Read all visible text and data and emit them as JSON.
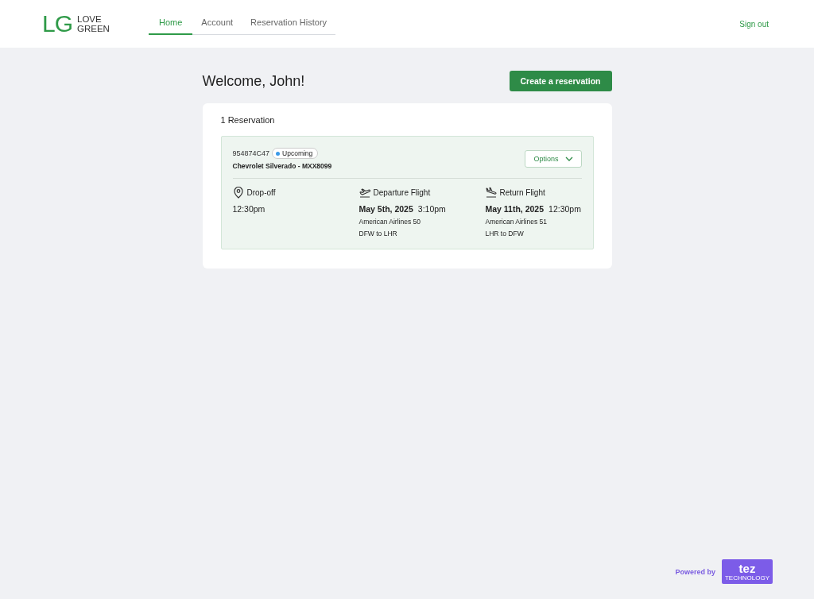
{
  "brand": {
    "mark": "LG",
    "name_lines": [
      "LOVE",
      "GREEN"
    ]
  },
  "nav": {
    "tabs": [
      {
        "label": "Home",
        "selected": true
      },
      {
        "label": "Account",
        "selected": false
      },
      {
        "label": "Reservation History",
        "selected": false
      }
    ],
    "sign_out": "Sign out"
  },
  "welcome": "Welcome, John!",
  "create_button": "Create a reservation",
  "reservations": {
    "count_label": "1 Reservation",
    "items": [
      {
        "code": "954874C47",
        "status": {
          "label": "Upcoming",
          "color": "#3b9ae8"
        },
        "vehicle": "Chevrolet Silverado - MXX8099",
        "options_button": "Options",
        "sections": [
          {
            "kind": "location",
            "title": "Drop-off",
            "time": "12:30pm"
          },
          {
            "kind": "departure",
            "title": "Departure Flight",
            "date": "May 5th, 2025",
            "time": "3:10pm",
            "airline": "American Airlines 50",
            "route": "DFW to LHR"
          },
          {
            "kind": "arrival",
            "title": "Return Flight",
            "date": "May 11th, 2025",
            "time": "12:30pm",
            "airline": "American Airlines 51",
            "route": "LHR to DFW"
          }
        ]
      }
    ]
  },
  "footer": {
    "powered_by": "Powered by",
    "logo_word": "tez",
    "logo_sub": "TECHNOLOGY"
  }
}
